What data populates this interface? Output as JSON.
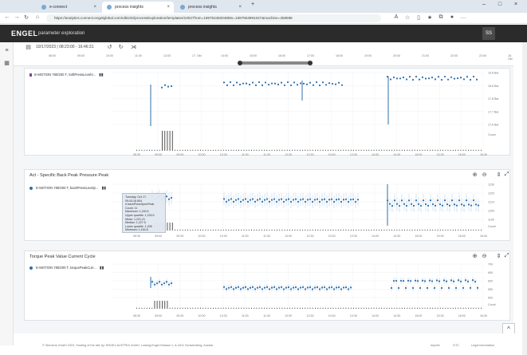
{
  "browser": {
    "tabs": [
      {
        "label": "e-connect"
      },
      {
        "label": "process insights"
      },
      {
        "label": "process insights"
      }
    ],
    "url": "https://analytics.connect.engelglobal.com/oibtz33/processExploration/templates/10027from=1697524820488to=1697553991047&machine=258588"
  },
  "app": {
    "logo": "ENGEL",
    "title": "parameter exploration",
    "avatar": "SS"
  },
  "toolbar": {
    "date_range": "10/17/2023 | 08:23:00 - 16:46:31",
    "timeline_labels": [
      "08:00",
      "09:00",
      "10:00",
      "11:00",
      "12:00",
      "17. Okt",
      "14:00",
      "15:00",
      "16:00",
      "17:00",
      "18:00",
      "19:00",
      "20:00",
      "21:00",
      "22:00",
      "23:00",
      "18. Okt"
    ]
  },
  "panels": [
    {
      "title": "",
      "legend": "E-MOTION 780/200 T, SoftPressLevelV...",
      "x_labels": [
        "08:30",
        "09:00",
        "09:30",
        "10:00",
        "10:30",
        "11:00",
        "11:30",
        "12:00",
        "12:30",
        "13:00",
        "13:30",
        "14:00",
        "14:30",
        "15:00",
        "15:30",
        "16:00",
        "16:30"
      ],
      "y_labels": [
        "19.8 Bar",
        "18.8 Bar",
        "17.8 Bar",
        "17.7 Bar",
        "17.6 Bar",
        "Count"
      ]
    },
    {
      "title": "Act - Specific Back Peak Pressure Peak",
      "legend": "E-MOTION 780/200 T, backPressLevelp...",
      "x_labels": [
        "08:30",
        "09:00",
        "09:30",
        "10:00",
        "10:30",
        "11:00",
        "11:30",
        "12:00",
        "12:30",
        "13:00",
        "13:30",
        "14:00",
        "14:30",
        "15:00",
        "15:30",
        "16:00",
        "16:30"
      ],
      "y_labels": [
        "1230",
        "1220",
        "1210",
        "1200",
        "1190",
        "Count"
      ]
    },
    {
      "title": "Torque Peak Value Current Cycle",
      "legend": "E-MOTION 780/200 T, torquePeakCurr...",
      "x_labels": [
        "08:30",
        "09:00",
        "09:30",
        "10:00",
        "10:30",
        "11:00",
        "11:30",
        "12:00",
        "12:30",
        "13:00",
        "13:30",
        "14:00",
        "14:30",
        "15:00",
        "15:30",
        "16:00",
        "16:30"
      ],
      "y_labels": [
        "700",
        "650",
        "600",
        "550",
        "500",
        "Count"
      ]
    }
  ],
  "tooltip": {
    "lines": [
      "Tuesday, Oct 17, 09:43:16.804",
      "● backPressSpecPeak",
      "Count: 11",
      "Maximum: 1,240.5",
      "Upper quartile: 1,233.9",
      "Mean: 1,221.21",
      "Median: 1,227.5",
      "Lower quartile: 1,208",
      "Minimum: 1,164.8"
    ]
  },
  "footer": {
    "copyright": "© Siemens GmbH 2023, Hosting of the site by: ENGEL AUSTRIA GmbH, Ludwig-Engel-Strasse 1, A-4311 Schwertberg, Austria",
    "links": [
      "Imprint",
      "GTC",
      "Legal information"
    ]
  },
  "colors": {
    "accent": "#2f6fa8",
    "appbar": "#2b2b2b"
  }
}
